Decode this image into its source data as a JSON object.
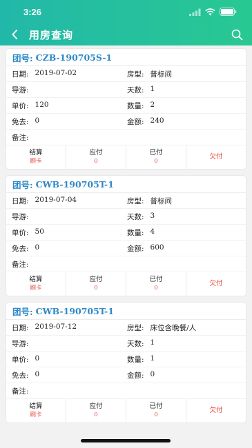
{
  "status": {
    "time": "3:26"
  },
  "nav": {
    "title": "用房查询"
  },
  "records": [
    {
      "group_label": "团号:",
      "group_no": "CZB-190705S-1",
      "date_label": "日期:",
      "date": "2019-07-02",
      "room_label": "房型:",
      "room": "普标间",
      "guide_label": "导游:",
      "guide": "",
      "days_label": "天数:",
      "days": "1",
      "price_label": "单价:",
      "price": "120",
      "qty_label": "数量:",
      "qty": "2",
      "free_label": "免去:",
      "free": "0",
      "amount_label": "金额:",
      "amount": "240",
      "note_label": "备注:",
      "note": "",
      "settle_label": "结算",
      "settle": "刷卡",
      "payable_label": "应付",
      "payable": "0",
      "paid_label": "已付",
      "paid": "0",
      "owed_label": "欠付",
      "owed": ""
    },
    {
      "group_label": "团号:",
      "group_no": "CWB-190705T-1",
      "date_label": "日期:",
      "date": "2019-07-04",
      "room_label": "房型:",
      "room": "普标间",
      "guide_label": "导游:",
      "guide": "",
      "days_label": "天数:",
      "days": "3",
      "price_label": "单价:",
      "price": "50",
      "qty_label": "数量:",
      "qty": "4",
      "free_label": "免去:",
      "free": "0",
      "amount_label": "金额:",
      "amount": "600",
      "note_label": "备注:",
      "note": "",
      "settle_label": "结算",
      "settle": "刷卡",
      "payable_label": "应付",
      "payable": "0",
      "paid_label": "已付",
      "paid": "0",
      "owed_label": "欠付",
      "owed": ""
    },
    {
      "group_label": "团号:",
      "group_no": "CWB-190705T-1",
      "date_label": "日期:",
      "date": "2019-07-12",
      "room_label": "房型:",
      "room": "床位含晚餐/人",
      "guide_label": "导游:",
      "guide": "",
      "days_label": "天数:",
      "days": "1",
      "price_label": "单价:",
      "price": "0",
      "qty_label": "数量:",
      "qty": "1",
      "free_label": "免去:",
      "free": "0",
      "amount_label": "金额:",
      "amount": "0",
      "note_label": "备注:",
      "note": "",
      "settle_label": "结算",
      "settle": "刷卡",
      "payable_label": "应付",
      "payable": "0",
      "paid_label": "已付",
      "paid": "0",
      "owed_label": "欠付",
      "owed": ""
    }
  ],
  "colors": {
    "header_start": "#22b8a9",
    "header_end": "#28c892",
    "title_blue": "#2e88c8",
    "value_red": "#e5463b"
  },
  "icons": {
    "back": "chevron-left-icon",
    "search": "search-icon"
  }
}
